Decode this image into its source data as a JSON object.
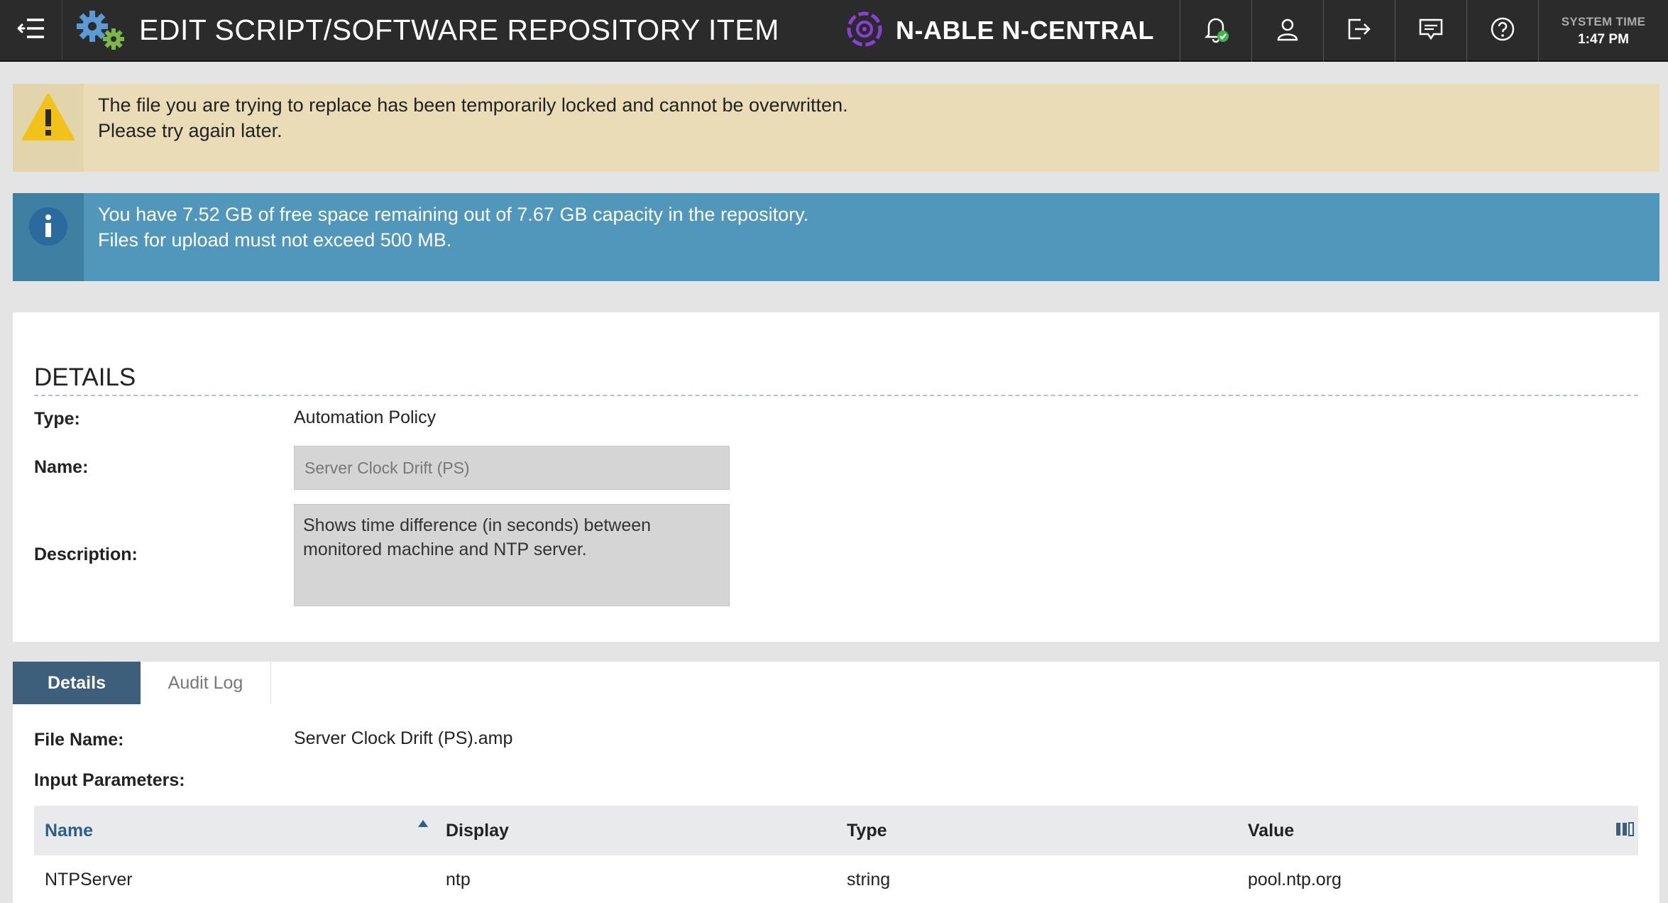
{
  "header": {
    "title": "EDIT SCRIPT/SOFTWARE REPOSITORY ITEM",
    "brand": "N-ABLE N-CENTRAL",
    "system_time_label": "SYSTEM TIME",
    "system_time": "1:47 PM",
    "icons": [
      "menu-collapse-icon",
      "gears-icon",
      "notification-bell-icon",
      "user-icon",
      "logout-icon",
      "feedback-icon",
      "help-icon"
    ]
  },
  "alerts": {
    "warning": {
      "line1": "The file you are trying to replace has been temporarily locked and cannot be overwritten.",
      "line2": "Please try again later."
    },
    "info": {
      "line1": "You have 7.52 GB of free space remaining out of 7.67 GB capacity in the repository.",
      "line2": "Files for upload must not exceed 500 MB."
    }
  },
  "details": {
    "section_title": "DETAILS",
    "type_label": "Type:",
    "type_value": "Automation Policy",
    "name_label": "Name:",
    "name_value": "Server Clock Drift (PS)",
    "description_label": "Description:",
    "description_value": "Shows time difference (in seconds) between monitored machine and NTP server."
  },
  "tabs": [
    {
      "label": "Details",
      "active": true
    },
    {
      "label": "Audit Log",
      "active": false
    }
  ],
  "file": {
    "file_name_label": "File Name:",
    "file_name_value": "Server Clock Drift (PS).amp",
    "input_params_label": "Input Parameters:"
  },
  "params_table": {
    "columns": [
      "Name",
      "Display",
      "Type",
      "Value"
    ],
    "rows": [
      [
        "NTPServer",
        "ntp",
        "string",
        "pool.ntp.org"
      ]
    ]
  },
  "colors": {
    "topbar": "#2b2b2b",
    "warning_bg": "#e9dcb6",
    "info_bg": "#5197bb",
    "active_tab": "#3d5f7c",
    "brand_purple": "#8b3fd9"
  }
}
